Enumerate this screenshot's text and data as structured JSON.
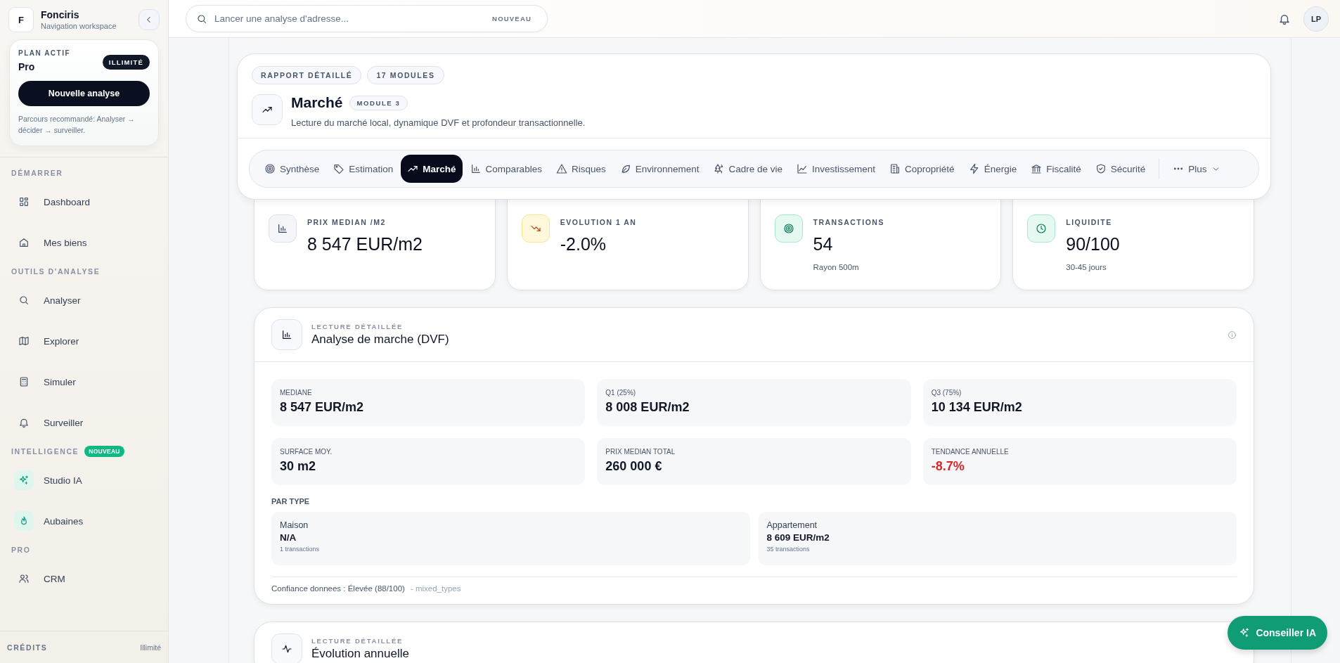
{
  "sidebar": {
    "brand": {
      "initial": "F",
      "name": "Fonciris",
      "subtitle": "Navigation workspace"
    },
    "plan": {
      "label": "PLAN ACTIF",
      "badge": "ILLIMITÉ",
      "name": "Pro",
      "button": "Nouvelle analyse",
      "hint": "Parcours recommandé: Analyser → décider → surveiller."
    },
    "sections": [
      {
        "title": "DÉMARRER",
        "items": [
          {
            "label": "Dashboard",
            "accent": false
          },
          {
            "label": "Mes biens",
            "accent": false
          }
        ]
      },
      {
        "title": "OUTILS D'ANALYSE",
        "items": [
          {
            "label": "Analyser",
            "accent": false
          },
          {
            "label": "Explorer",
            "accent": false
          },
          {
            "label": "Simuler",
            "accent": false
          },
          {
            "label": "Surveiller",
            "accent": false
          }
        ]
      },
      {
        "title": "INTELLIGENCE",
        "badge": "NOUVEAU",
        "items": [
          {
            "label": "Studio IA",
            "accent": true
          },
          {
            "label": "Aubaines",
            "accent": true
          }
        ]
      },
      {
        "title": "PRO",
        "items": [
          {
            "label": "CRM",
            "accent": false
          }
        ]
      }
    ],
    "footer": {
      "label": "CRÉDITS",
      "value": "Illimité"
    }
  },
  "topbar": {
    "search": {
      "placeholder": "Lancer une analyse d'adresse...",
      "badge": "NOUVEAU"
    },
    "avatar": "LP"
  },
  "report": {
    "tags": [
      "RAPPORT DÉTAILLÉ",
      "17 MODULES"
    ],
    "title": "Marché",
    "module": "MODULE 3",
    "description": "Lecture du marché local, dynamique DVF et profondeur transactionnelle.",
    "tabs": [
      {
        "label": "Synthèse",
        "selected": false
      },
      {
        "label": "Estimation",
        "selected": false
      },
      {
        "label": "Marché",
        "selected": true
      },
      {
        "label": "Comparables",
        "selected": false
      },
      {
        "label": "Risques",
        "selected": false
      },
      {
        "label": "Environnement",
        "selected": false
      },
      {
        "label": "Cadre de vie",
        "selected": false
      },
      {
        "label": "Investissement",
        "selected": false
      },
      {
        "label": "Copropriété",
        "selected": false
      },
      {
        "label": "Énergie",
        "selected": false
      },
      {
        "label": "Fiscalité",
        "selected": false
      },
      {
        "label": "Sécurité",
        "selected": false
      }
    ],
    "more": "Plus"
  },
  "kpis": [
    {
      "kind": "neutral",
      "label": "PRIX MEDIAN /M2",
      "value": "8 547 EUR/m2"
    },
    {
      "kind": "warning",
      "label": "EVOLUTION 1 AN",
      "value": "-2.0%"
    },
    {
      "kind": "success",
      "label": "TRANSACTIONS",
      "value": "54",
      "note": "Rayon 500m"
    },
    {
      "kind": "success",
      "label": "LIQUIDITE",
      "value": "90/100",
      "note": "30-45 jours"
    }
  ],
  "market": {
    "eyebrow": "LECTURE DÉTAILLÉE",
    "title": "Analyse de marche (DVF)",
    "stats": [
      {
        "label": "MEDIANE",
        "value": "8 547 EUR/m2",
        "negative": false
      },
      {
        "label": "Q1 (25%)",
        "value": "8 008 EUR/m2",
        "negative": false
      },
      {
        "label": "Q3 (75%)",
        "value": "10 134 EUR/m2",
        "negative": false
      },
      {
        "label": "SURFACE MOY.",
        "value": "30 m2",
        "negative": false
      },
      {
        "label": "PRIX MEDIAN TOTAL",
        "value": "260 000 €",
        "negative": false
      },
      {
        "label": "TENDANCE ANNUELLE",
        "value": "-8.7%",
        "negative": true
      }
    ],
    "by_type_title": "PAR TYPE",
    "by_type": [
      {
        "name": "Maison",
        "value": "N/A",
        "count": "1 transactions"
      },
      {
        "name": "Appartement",
        "value": "8 609 EUR/m2",
        "count": "35 transactions"
      }
    ],
    "confidence": "Confiance donnees : Élevée (88/100)",
    "confidence_note": "- mixed_types"
  },
  "next_section": {
    "eyebrow": "LECTURE DÉTAILLÉE",
    "title": "Évolution annuelle"
  },
  "assistant_button": "Conseiller IA"
}
